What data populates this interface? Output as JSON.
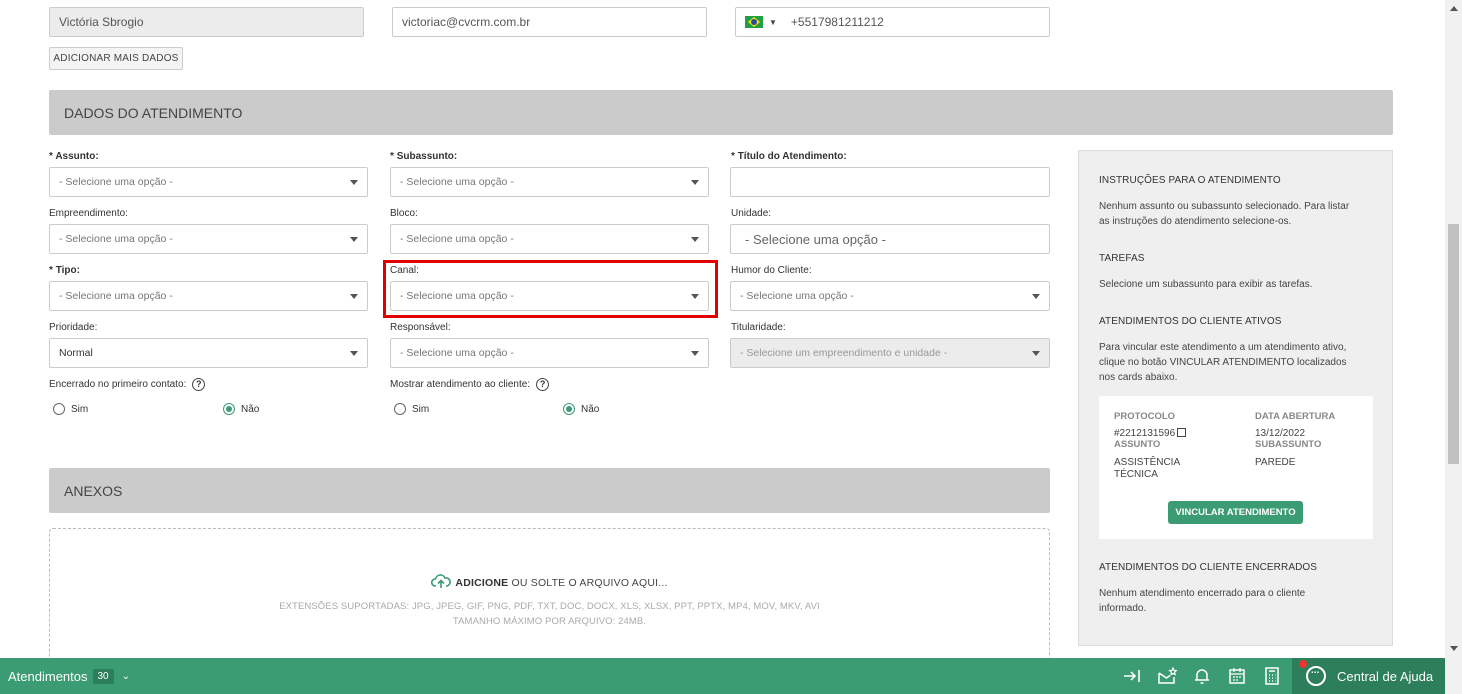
{
  "contact": {
    "name": "Victória Sbrogio",
    "email": "victoriac@cvcrm.com.br",
    "phone": "+5517981211212",
    "country_flag_icon": "brazil-flag-icon",
    "add_more_label": "ADICIONAR MAIS DADOS"
  },
  "atendimento": {
    "section_title": "DADOS DO ATENDIMENTO",
    "assunto": {
      "label": "Assunto:",
      "value": "- Selecione uma opção -"
    },
    "subassunto": {
      "label": "Subassunto:",
      "value": "- Selecione uma opção -"
    },
    "titulo": {
      "label": "Título do Atendimento:",
      "value": ""
    },
    "empreendimento": {
      "label": "Empreendimento:",
      "value": "- Selecione uma opção -"
    },
    "bloco": {
      "label": "Bloco:",
      "value": "- Selecione uma opção -"
    },
    "unidade": {
      "label": "Unidade:",
      "value": "- Selecione uma opção -"
    },
    "tipo": {
      "label": "Tipo:",
      "value": "- Selecione uma opção -"
    },
    "canal": {
      "label": "Canal:",
      "value": "- Selecione uma opção -"
    },
    "humor": {
      "label": "Humor do Cliente:",
      "value": "- Selecione uma opção -"
    },
    "prioridade": {
      "label": "Prioridade:",
      "value": "Normal"
    },
    "responsavel": {
      "label": "Responsável:",
      "value": "- Selecione uma opção -"
    },
    "titularidade": {
      "label": "Titularidade:",
      "value": "- Selecione um empreendimento e unidade -"
    },
    "required_mark": "*",
    "encerrado": {
      "label": "Encerrado no primeiro contato:",
      "sim": "Sim",
      "nao": "Não",
      "selected": "nao"
    },
    "mostrar": {
      "label": "Mostrar atendimento ao cliente:",
      "sim": "Sim",
      "nao": "Não",
      "selected": "nao"
    },
    "help_glyph": "?"
  },
  "anexos": {
    "section_title": "ANEXOS",
    "add_strong": "ADICIONE",
    "add_rest": "OU SOLTE O ARQUIVO AQUI...",
    "extensions": "EXTENSÕES SUPORTADAS: JPG, JPEG, GIF, PNG, PDF, TXT, DOC, DOCX, XLS, XLSX, PPT, PPTX, MP4, MOV, MKV, AVI",
    "max_size": "TAMANHO MÁXIMO POR ARQUIVO: 24MB."
  },
  "side": {
    "instrucoes_title": "INSTRUÇÕES PARA O ATENDIMENTO",
    "instrucoes_text": "Nenhum assunto ou subassunto selecionado. Para listar as instruções do atendimento selecione-os.",
    "tarefas_title": "TAREFAS",
    "tarefas_text": "Selecione um subassunto para exibir as tarefas.",
    "ativos_title": "ATENDIMENTOS DO CLIENTE ATIVOS",
    "ativos_text": "Para vincular este atendimento a um atendimento ativo, clique no botão VINCULAR ATENDIMENTO localizados nos cards abaixo.",
    "card": {
      "protocolo_label": "PROTOCOLO",
      "protocolo_value": "#2212131596",
      "abertura_label": "DATA ABERTURA",
      "abertura_value": "13/12/2022",
      "assunto_label": "ASSUNTO",
      "assunto_value": "ASSISTÊNCIA TÉCNICA",
      "subassunto_label": "SUBASSUNTO",
      "subassunto_value": "PAREDE",
      "button": "VINCULAR ATENDIMENTO"
    },
    "encerrados_title": "ATENDIMENTOS DO CLIENTE ENCERRADOS",
    "encerrados_text": "Nenhum atendimento encerrado para o cliente informado."
  },
  "bottombar": {
    "atendimentos_label": "Atendimentos",
    "atendimentos_count": "30",
    "help_center": "Central de Ajuda",
    "icons": [
      "sign-in-icon",
      "mail-star-icon",
      "bell-icon",
      "calendar-icon",
      "calculator-icon"
    ]
  },
  "colors": {
    "accent": "#3b9b73",
    "highlight": "#e00000",
    "section_bg": "#cbcbcb"
  }
}
